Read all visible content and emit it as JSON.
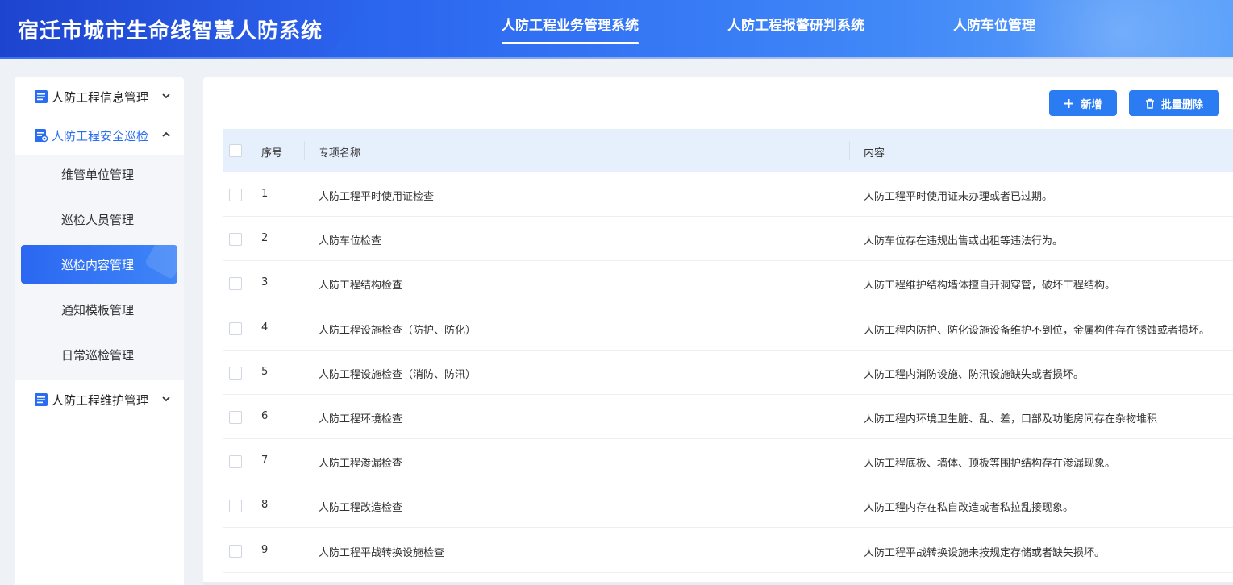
{
  "header": {
    "title": "宿迁市城市生命线智慧人防系统",
    "nav": [
      {
        "label": "人防工程业务管理系统",
        "active": true
      },
      {
        "label": "人防工程报警研判系统",
        "active": false
      },
      {
        "label": "人防车位管理",
        "active": false
      }
    ]
  },
  "sidebar": {
    "groups": [
      {
        "label": "人防工程信息管理",
        "icon": "document-icon",
        "expanded": false
      },
      {
        "label": "人防工程安全巡检",
        "icon": "inspection-icon",
        "expanded": true
      },
      {
        "label": "人防工程维护管理",
        "icon": "document-icon",
        "expanded": false
      }
    ],
    "submenu": [
      {
        "label": "维管单位管理",
        "active": false
      },
      {
        "label": "巡检人员管理",
        "active": false
      },
      {
        "label": "巡检内容管理",
        "active": true
      },
      {
        "label": "通知模板管理",
        "active": false
      },
      {
        "label": "日常巡检管理",
        "active": false
      }
    ]
  },
  "toolbar": {
    "add_label": "新增",
    "batch_delete_label": "批量删除"
  },
  "table": {
    "columns": [
      "序号",
      "专项名称",
      "内容"
    ],
    "rows": [
      {
        "no": "1",
        "name": "人防工程平时使用证检查",
        "content": "人防工程平时使用证未办理或者已过期。"
      },
      {
        "no": "2",
        "name": "人防车位检查",
        "content": "人防车位存在违规出售或出租等违法行为。"
      },
      {
        "no": "3",
        "name": "人防工程结构检查",
        "content": "人防工程维护结构墙体擅自开洞穿管，破坏工程结构。"
      },
      {
        "no": "4",
        "name": "人防工程设施检查（防护、防化）",
        "content": "人防工程内防护、防化设施设备维护不到位，金属构件存在锈蚀或者损坏。"
      },
      {
        "no": "5",
        "name": "人防工程设施检查（消防、防汛）",
        "content": "人防工程内消防设施、防汛设施缺失或者损坏。"
      },
      {
        "no": "6",
        "name": "人防工程环境检查",
        "content": "人防工程内环境卫生脏、乱、差，口部及功能房间存在杂物堆积"
      },
      {
        "no": "7",
        "name": "人防工程渗漏检查",
        "content": "人防工程底板、墙体、顶板等围护结构存在渗漏现象。"
      },
      {
        "no": "8",
        "name": "人防工程改造检查",
        "content": "人防工程内存在私自改造或者私拉乱接现象。"
      },
      {
        "no": "9",
        "name": "人防工程平战转换设施检查",
        "content": "人防工程平战转换设施未按规定存储或者缺失损坏。"
      }
    ]
  },
  "colors": {
    "primary": "#2b7cf3",
    "header_start": "#1e4fe0",
    "header_end": "#5ea3fb",
    "table_header_bg": "#e6effc",
    "active_menu_text": "#2a6ef0"
  }
}
